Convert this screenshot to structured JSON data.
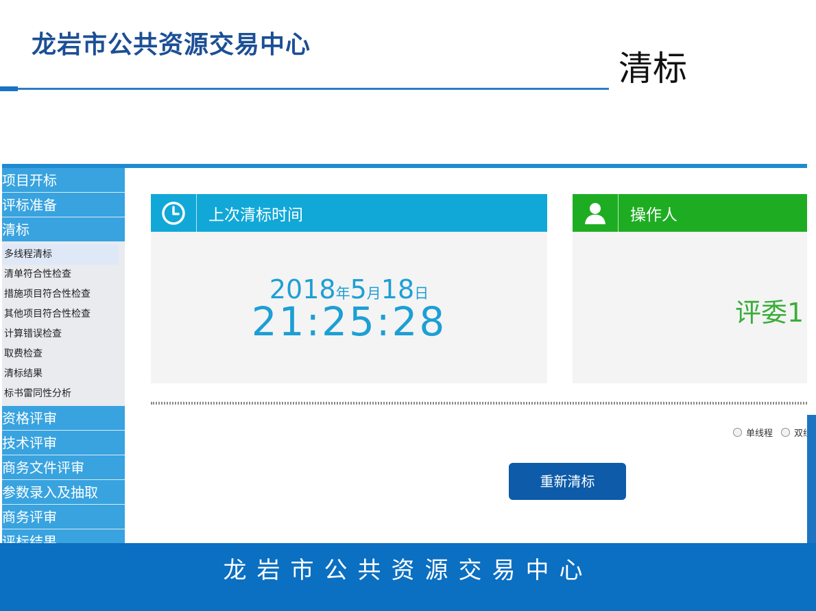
{
  "slide": {
    "org_title": "龙岩市公共资源交易中心",
    "page_title": "清标",
    "footer_text": "龙岩市公共资源交易中心"
  },
  "sidebar": {
    "sections_top": [
      {
        "label": "项目开标"
      },
      {
        "label": "评标准备"
      },
      {
        "label": "清标"
      }
    ],
    "sub_items": [
      {
        "label": "多线程清标"
      },
      {
        "label": "清单符合性检查"
      },
      {
        "label": "措施项目符合性检查"
      },
      {
        "label": "其他项目符合性检查"
      },
      {
        "label": "计算错误检查"
      },
      {
        "label": "取费检查"
      },
      {
        "label": "清标结果"
      },
      {
        "label": "标书雷同性分析"
      }
    ],
    "sections_bottom": [
      {
        "label": "资格评审"
      },
      {
        "label": "技术评审"
      },
      {
        "label": "商务文件评审"
      },
      {
        "label": "参数录入及抽取"
      },
      {
        "label": "商务评审"
      },
      {
        "label": "评标结果"
      }
    ]
  },
  "time_panel": {
    "header": "上次清标时间",
    "year": "2018",
    "year_unit": "年",
    "month": "5",
    "month_unit": "月",
    "day": "18",
    "day_unit": "日",
    "time": "21:25:28",
    "icon": "clock-icon",
    "color": "#11a8d8"
  },
  "operator_panel": {
    "header": "操作人",
    "name": "评委1",
    "icon": "user-icon",
    "color": "#1ead22"
  },
  "mode_options": [
    {
      "label": "单线程"
    },
    {
      "label": "双线程"
    }
  ],
  "redo_button": {
    "label": "重新清标"
  },
  "colors": {
    "title_blue": "#1c4f95",
    "sidebar_blue": "#39a3df",
    "button_blue": "#0d5ba9",
    "footer_blue": "#0b6fc2"
  }
}
